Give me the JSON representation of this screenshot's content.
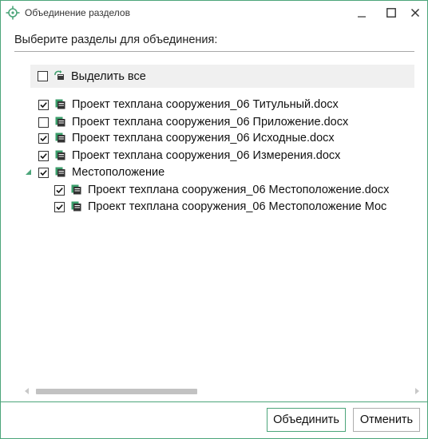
{
  "window": {
    "title": "Объединение разделов",
    "accent_color": "#4ca57a",
    "icons": {
      "app": "target-icon",
      "minimize": "minimize-icon",
      "maximize": "maximize-icon",
      "close": "close-icon"
    }
  },
  "prompt": "Выберите разделы для объединения:",
  "select_all": {
    "label": "Выделить все",
    "checked": false,
    "icon": "refresh-doc-icon"
  },
  "items": [
    {
      "label": "Проект техплана сооружения_06 Титульный.docx",
      "checked": true,
      "icon": "doc-icon"
    },
    {
      "label": "Проект техплана сооружения_06 Приложение.docx",
      "checked": false,
      "icon": "doc-icon"
    },
    {
      "label": "Проект техплана сооружения_06 Исходные.docx",
      "checked": true,
      "icon": "doc-icon"
    },
    {
      "label": "Проект техплана сооружения_06 Измерения.docx",
      "checked": true,
      "icon": "doc-icon"
    }
  ],
  "group": {
    "label": "Местоположение",
    "checked": true,
    "expanded": true,
    "icon": "doc-icon",
    "children": [
      {
        "label": "Проект техплана сооружения_06 Местоположение.docx",
        "checked": true,
        "icon": "doc-icon"
      },
      {
        "label": "Проект техплана сооружения_06 Местоположение Мос",
        "checked": true,
        "icon": "doc-icon"
      }
    ]
  },
  "buttons": {
    "ok": "Объединить",
    "cancel": "Отменить"
  }
}
